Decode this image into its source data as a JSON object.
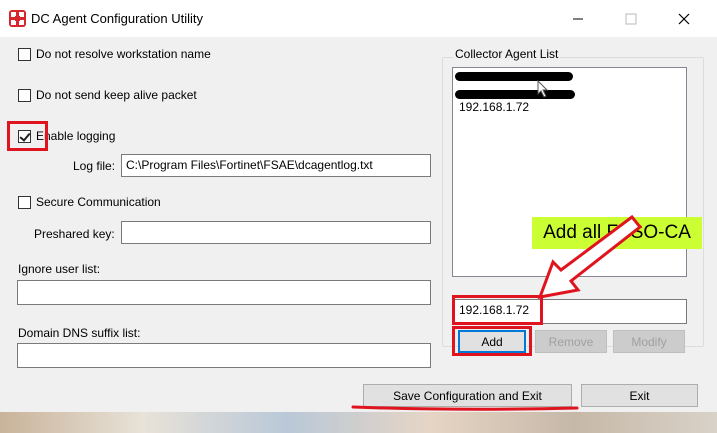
{
  "window": {
    "title": "DC Agent Configuration Utility",
    "minimize_icon": "minimize-icon",
    "maximize_icon": "maximize-icon",
    "close_icon": "close-icon"
  },
  "options": {
    "no_resolve": {
      "label": "Do not resolve workstation name",
      "checked": false
    },
    "no_keepalive": {
      "label": "Do not send keep alive packet",
      "checked": false
    },
    "enable_logging": {
      "label": "Enable logging",
      "checked": true
    },
    "secure_comm": {
      "label": "Secure Communication",
      "checked": false
    }
  },
  "fields": {
    "log_file_label": "Log file:",
    "log_file_value": "C:\\Program Files\\Fortinet\\FSAE\\dcagentlog.txt",
    "preshared_key_label": "Preshared key:",
    "preshared_key_value": "",
    "ignore_user_label": "Ignore user list:",
    "ignore_user_value": "",
    "dns_suffix_label": "Domain DNS suffix list:",
    "dns_suffix_value": ""
  },
  "collector": {
    "group_title": "Collector Agent List",
    "items": [
      "192.168.1.72"
    ],
    "input_value": "192.168.1.72",
    "add_label": "Add",
    "remove_label": "Remove",
    "modify_label": "Modify"
  },
  "footer": {
    "save_label": "Save Configuration and Exit",
    "exit_label": "Exit"
  },
  "annotation": {
    "callout_text": "Add all FSSO-CA",
    "accent_color": "#e0141e",
    "callout_color": "#ccff33"
  }
}
